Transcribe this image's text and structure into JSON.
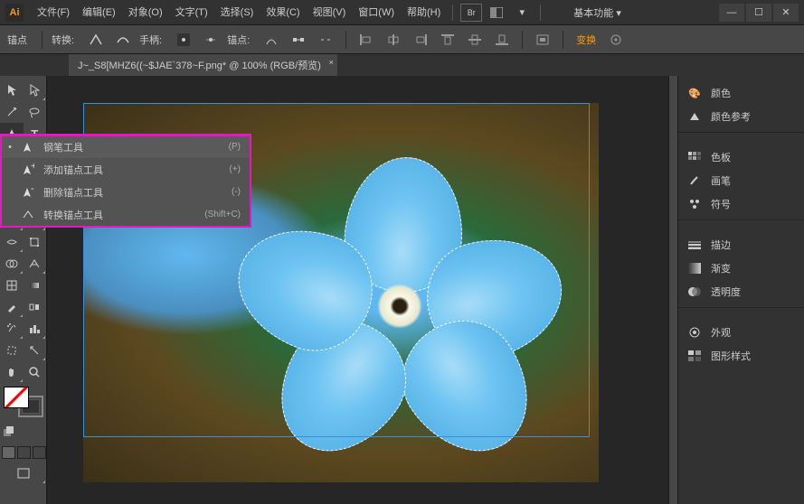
{
  "app_logo": "Ai",
  "menu": {
    "file": "文件(F)",
    "edit": "编辑(E)",
    "object": "对象(O)",
    "type": "文字(T)",
    "select": "选择(S)",
    "effect": "效果(C)",
    "view": "视图(V)",
    "window": "窗口(W)",
    "help": "帮助(H)"
  },
  "basic_mode": "基本功能",
  "options": {
    "anchor": "锚点",
    "convert": "转换:",
    "handle": "手柄:",
    "anchor2": "锚点:",
    "transform": "变换"
  },
  "tab": {
    "title": "J~_S8[MHZ6((~$JAE`378~F.png* @ 100% (RGB/预览)"
  },
  "flyout": {
    "pen": {
      "label": "钢笔工具",
      "shortcut": "(P)"
    },
    "add": {
      "label": "添加锚点工具",
      "shortcut": "(+)"
    },
    "del": {
      "label": "删除锚点工具",
      "shortcut": "(-)"
    },
    "conv": {
      "label": "转换锚点工具",
      "shortcut": "(Shift+C)"
    }
  },
  "panels": {
    "color": "颜色",
    "color_guide": "颜色参考",
    "swatches": "色板",
    "brushes": "画笔",
    "symbols": "符号",
    "stroke": "描边",
    "gradient": "渐变",
    "transparency": "透明度",
    "appearance": "外观",
    "graphic_styles": "图形样式"
  }
}
